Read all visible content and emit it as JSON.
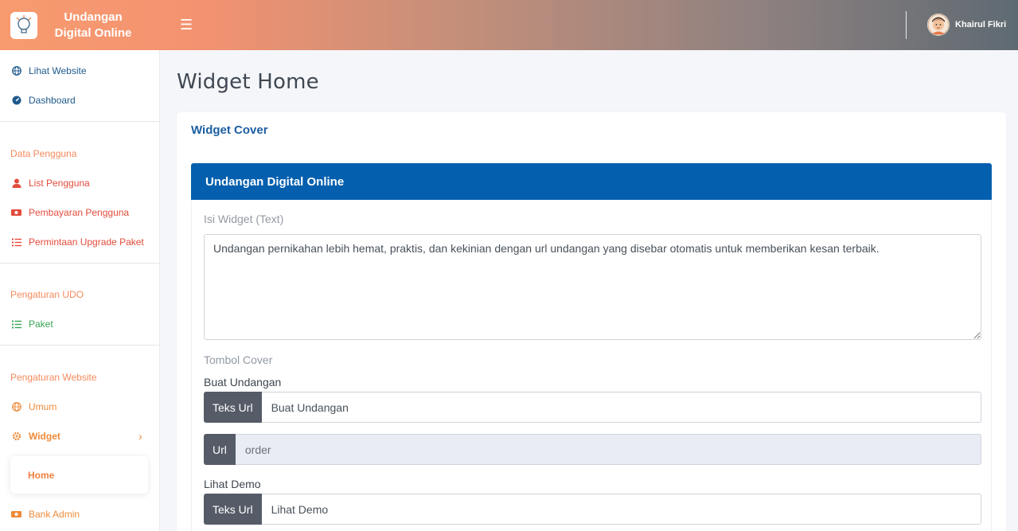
{
  "brand": {
    "title_line1": "Undangan",
    "title_line2": "Digital Online"
  },
  "topbar": {
    "user_name": "Khairul Fikri"
  },
  "sidebar": {
    "items_top": [
      {
        "label": "Lihat Website",
        "icon": "globe-icon"
      },
      {
        "label": "Dashboard",
        "icon": "dashboard-icon"
      }
    ],
    "section_users": {
      "heading": "Data Pengguna",
      "items": [
        {
          "label": "List Pengguna",
          "icon": "user-icon"
        },
        {
          "label": "Pembayaran Pengguna",
          "icon": "money-icon"
        },
        {
          "label": "Permintaan Upgrade Paket",
          "icon": "list-icon"
        }
      ]
    },
    "section_udo": {
      "heading": "Pengaturan UDO",
      "items": [
        {
          "label": "Paket",
          "icon": "list-icon"
        }
      ]
    },
    "section_website": {
      "heading": "Pengaturan Website",
      "items": [
        {
          "label": "Umum",
          "icon": "globe-icon"
        },
        {
          "label": "Widget",
          "icon": "gear-icon"
        },
        {
          "label": "Home"
        },
        {
          "label": "Bank Admin",
          "icon": "money-icon"
        }
      ]
    }
  },
  "main": {
    "page_title": "Widget Home",
    "card_title": "Widget Cover",
    "panel_title": "Undangan Digital Online",
    "text_label": "Isi Widget (Text)",
    "text_value": "Undangan pernikahan lebih hemat, praktis, dan kekinian dengan url undangan yang disebar otomatis untuk memberikan kesan terbaik.",
    "buttons_label": "Tombol Cover",
    "button1": {
      "title": "Buat Undangan",
      "text_addon": "Teks Url",
      "text_value": "Buat Undangan",
      "url_addon": "Url",
      "url_value": "order"
    },
    "button2": {
      "title": "Lihat Demo",
      "text_addon": "Teks Url",
      "text_value": "Lihat Demo"
    }
  },
  "colors": {
    "header_start": "#f79b6f",
    "header_end": "#5e6a72",
    "panel_blue": "#045fae",
    "accent_orange": "#f08040"
  }
}
